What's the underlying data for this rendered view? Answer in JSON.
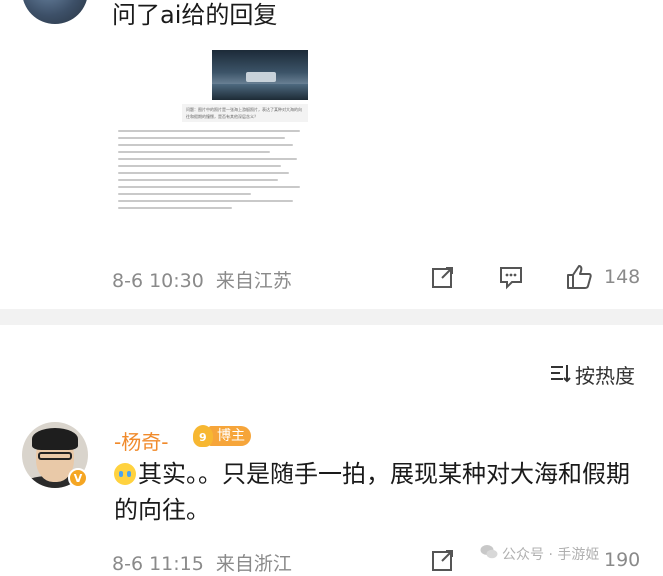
{
  "comment1": {
    "text": "问了ai给的回复",
    "image_caption": "问题：图片中的照片是一张海上游艇照片，表达了某种对大海的向往和假期的憧憬，是否有其他深层含义？",
    "time": "8-6 10:30",
    "location": "来自江苏",
    "likes": "148"
  },
  "sort": {
    "label": "按热度"
  },
  "comment2": {
    "username": "-杨奇-",
    "badge_level": "9",
    "badge_label": "博主",
    "text": "其实。。只是随手一拍，展现某种对大海和假期的向往。",
    "time": "8-6 11:15",
    "location": "来自浙江",
    "likes": "190"
  },
  "watermark": {
    "text": "公众号 · 手游姬"
  },
  "colors": {
    "username": "#f08a2b",
    "meta": "#8a8a8a",
    "badge": "#f6a53a"
  }
}
